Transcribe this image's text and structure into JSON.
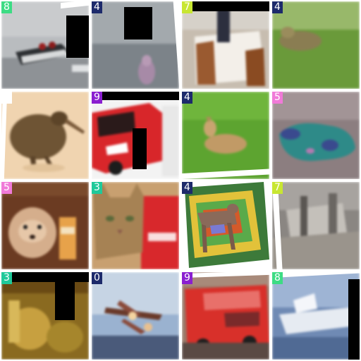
{
  "grid": {
    "tiles": [
      {
        "label": "8",
        "subject": "motorboat on water",
        "badge_bg": "#3ddc84",
        "badge_fg": "#ffffff"
      },
      {
        "label": "4",
        "subject": "deer in hazy field",
        "badge_bg": "#1d2a6b",
        "badge_fg": "#ffffff"
      },
      {
        "label": "7",
        "subject": "horse with rider",
        "badge_bg": "#c8e632",
        "badge_fg": "#ffffff"
      },
      {
        "label": "4",
        "subject": "deer in grass",
        "badge_bg": "#1d2a6b",
        "badge_fg": "#ffffff"
      },
      {
        "label": "",
        "subject": "kiwi bird",
        "badge_bg": "#ffffff",
        "badge_fg": "#000000"
      },
      {
        "label": "9",
        "subject": "red truck",
        "badge_bg": "#8a1fd0",
        "badge_fg": "#ffffff"
      },
      {
        "label": "4",
        "subject": "deer lying in grass",
        "badge_bg": "#1d2a6b",
        "badge_fg": "#ffffff"
      },
      {
        "label": "5",
        "subject": "abstract color-distorted dog",
        "badge_bg": "#f07ad8",
        "badge_fg": "#ffffff"
      },
      {
        "label": "5",
        "subject": "fluffy puppy",
        "badge_bg": "#f07ad8",
        "badge_fg": "#ffffff"
      },
      {
        "label": "3",
        "subject": "tabby cat",
        "badge_bg": "#1fc99a",
        "badge_fg": "#ffffff"
      },
      {
        "label": "4",
        "subject": "posterized deer",
        "badge_bg": "#1d2a6b",
        "badge_fg": "#ffffff"
      },
      {
        "label": "7",
        "subject": "blurry horse",
        "badge_bg": "#c8e632",
        "badge_fg": "#ffffff"
      },
      {
        "label": "3",
        "subject": "cat in golden light",
        "badge_bg": "#1fc99a",
        "badge_fg": "#ffffff"
      },
      {
        "label": "0",
        "subject": "airplane in sky",
        "badge_bg": "#1d2a6b",
        "badge_fg": "#ffffff"
      },
      {
        "label": "9",
        "subject": "red fire truck",
        "badge_bg": "#8a1fd0",
        "badge_fg": "#ffffff"
      },
      {
        "label": "8",
        "subject": "ship on sea",
        "badge_bg": "#3ddc84",
        "badge_fg": "#ffffff"
      }
    ]
  },
  "background_color": "#ffffff"
}
